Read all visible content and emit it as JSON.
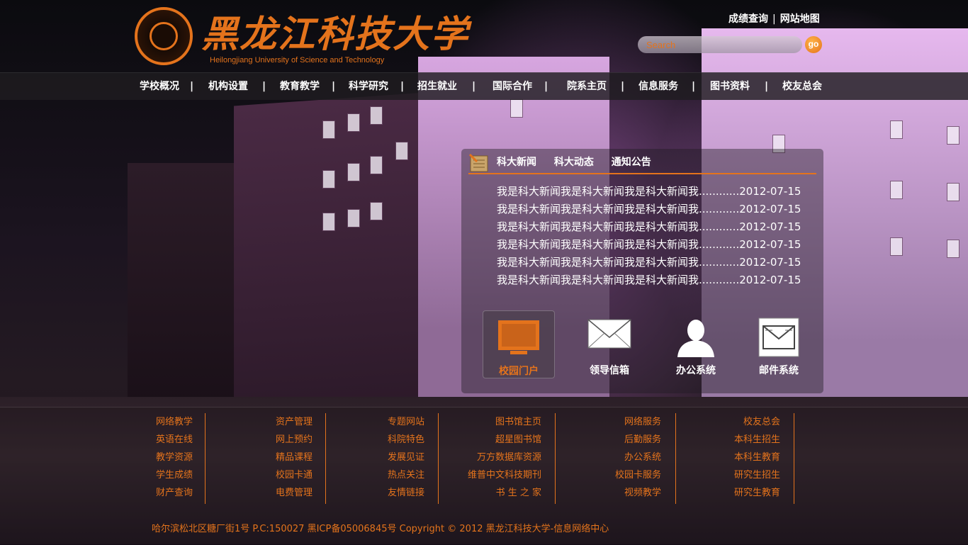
{
  "colors": {
    "accent": "#e4731c",
    "nav_bg": "#1e1c20",
    "text": "#ffffff"
  },
  "header": {
    "logo_cn": "黑龙江科技大学",
    "logo_en": "Heilongjiang University of Science and Technology",
    "links": [
      "成绩查询",
      "网站地图"
    ],
    "search": {
      "placeholder": "Search",
      "button": "go"
    }
  },
  "nav": {
    "items": [
      "学校概况",
      "机构设置",
      "教育教学",
      "科学研究",
      "招生就业",
      "国际合作",
      "院系主页",
      "信息服务",
      "图书资料",
      "校友总会"
    ],
    "separator": "|"
  },
  "news": {
    "icon": "notebook-icon",
    "tabs": [
      "科大新闻",
      "科大动态",
      "通知公告"
    ],
    "items": [
      {
        "title": "我是科大新闻我是科大新闻我是科大新闻我............",
        "date": "2012-07-15"
      },
      {
        "title": "我是科大新闻我是科大新闻我是科大新闻我............",
        "date": "2012-07-15"
      },
      {
        "title": "我是科大新闻我是科大新闻我是科大新闻我............",
        "date": "2012-07-15"
      },
      {
        "title": "我是科大新闻我是科大新闻我是科大新闻我............",
        "date": "2012-07-15"
      },
      {
        "title": "我是科大新闻我是科大新闻我是科大新闻我............",
        "date": "2012-07-15"
      },
      {
        "title": "我是科大新闻我是科大新闻我是科大新闻我............",
        "date": "2012-07-15"
      }
    ]
  },
  "quick_links": [
    {
      "label": "校园门户",
      "icon": "monitor-icon"
    },
    {
      "label": "领导信箱",
      "icon": "envelope-icon"
    },
    {
      "label": "办公系统",
      "icon": "person-icon"
    },
    {
      "label": "邮件系统",
      "icon": "mail-inbox-icon"
    }
  ],
  "footer": {
    "columns": [
      [
        "网络教学",
        "英语在线",
        "教学资源",
        "学生成绩",
        "财产查询"
      ],
      [
        "资产管理",
        "网上预约",
        "精品课程",
        "校园卡通",
        "电费管理"
      ],
      [
        "专题网站",
        "科院特色",
        "发展见证",
        "热点关注",
        "友情链接"
      ],
      [
        "图书馆主页",
        "超星图书馆",
        "万方数据库资源",
        "维普中文科技期刊",
        "书 生 之 家"
      ],
      [
        "网络服务",
        "后勤服务",
        "办公系统",
        "校园卡服务",
        "视频教学"
      ],
      [
        "校友总会",
        "本科生招生",
        "本科生教育",
        "研究生招生",
        "研究生教育"
      ]
    ],
    "copyright": "哈尔滨松北区糖厂街1号 P.C:150027  黑ICP备05006845号   Copyright © 2012  黑龙江科技大学-信息网络中心"
  }
}
